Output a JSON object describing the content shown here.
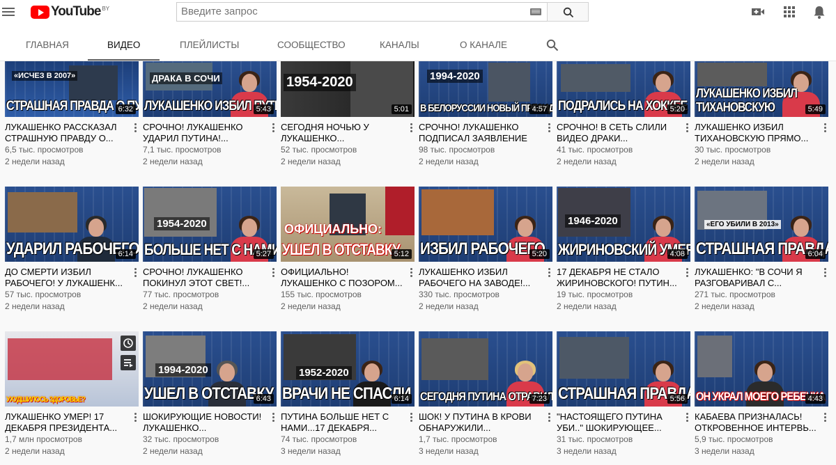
{
  "header": {
    "logo_text": "YouTube",
    "logo_region": "BY",
    "search_placeholder": "Введите запрос"
  },
  "tabs": [
    {
      "label": "ГЛАВНАЯ"
    },
    {
      "label": "ВИДЕО"
    },
    {
      "label": "ПЛЕЙЛИСТЫ"
    },
    {
      "label": "СООБЩЕСТВО"
    },
    {
      "label": "КАНАЛЫ"
    },
    {
      "label": "О КАНАЛЕ"
    }
  ],
  "videos": [
    {
      "thumb_caption": "СТРАШНАЯ ПРАВДА О ПУТИНЕ",
      "thumb_label": "«ИСЧЕЗ В 2007»",
      "duration": "6:32",
      "title": "ЛУКАШЕНКО РАССКАЗАЛ СТРАШНУЮ ПРАВДУ О...",
      "views": "6,5 тыс. просмотров",
      "age": "2 недели назад"
    },
    {
      "thumb_caption": "ЛУКАШЕНКО ИЗБИЛ ПУТИНА",
      "thumb_label": "ДРАКА В СОЧИ",
      "duration": "5:43",
      "title": "СРОЧНО! ЛУКАШЕНКО УДАРИЛ ПУТИНА!...",
      "views": "7,1 тыс. просмотров",
      "age": "2 недели назад"
    },
    {
      "thumb_caption": "",
      "thumb_label": "1954-2020",
      "duration": "5:01",
      "title": "СЕГОДНЯ НОЧЬЮ У ЛУКАШЕНКО...",
      "views": "52 тыс. просмотров",
      "age": "2 недели назад"
    },
    {
      "thumb_caption": "В БЕЛОРУССИИ НОВЫЙ ПРЕЗИДЕНТ",
      "thumb_label": "1994-2020",
      "duration": "4:57",
      "title": "СРОЧНО! ЛУКАШЕНКО ПОДПИСАЛ ЗАЯВЛЕНИЕ О...",
      "views": "98 тыс. просмотров",
      "age": "2 недели назад"
    },
    {
      "thumb_caption": "ПОДРАЛИСЬ НА ХОККЕЕ",
      "thumb_label": "",
      "duration": "5:20",
      "title": "СРОЧНО! В СЕТЬ СЛИЛИ ВИДЕО ДРАКИ...",
      "views": "41 тыс. просмотров",
      "age": "2 недели назад"
    },
    {
      "thumb_caption": "ЛУКАШЕНКО ИЗБИЛ ТИХАНОВСКУЮ",
      "thumb_label": "",
      "duration": "5:49",
      "title": "ЛУКАШЕНКО ИЗБИЛ ТИХАНОВСКУЮ ПРЯМО...",
      "views": "30 тыс. просмотров",
      "age": "2 недели назад"
    },
    {
      "thumb_caption": "УДАРИЛ РАБОЧЕГО",
      "thumb_label": "",
      "duration": "6:14",
      "title": "ДО СМЕРТИ ИЗБИЛ РАБОЧЕГО! У ЛУКАШЕНК...",
      "views": "57 тыс. просмотров",
      "age": "2 недели назад"
    },
    {
      "thumb_caption": "БОЛЬШЕ НЕТ С НАМИ",
      "thumb_label": "1954-2020",
      "duration": "5:27",
      "title": "СРОЧНО! ЛУКАШЕНКО ПОКИНУЛ ЭТОТ СВЕТ!...",
      "views": "77 тыс. просмотров",
      "age": "2 недели назад"
    },
    {
      "thumb_caption": "УШЕЛ В ОТСТАВКУ",
      "thumb_label": "ОФИЦИАЛЬНО:",
      "duration": "5:12",
      "title": "ОФИЦИАЛЬНО! ЛУКАШЕНКО С ПОЗОРОМ...",
      "views": "155 тыс. просмотров",
      "age": "2 недели назад"
    },
    {
      "thumb_caption": "ИЗБИЛ РАБОЧЕГО",
      "thumb_label": "",
      "duration": "5:20",
      "title": "ЛУКАШЕНКО ИЗБИЛ РАБОЧЕГО НА ЗАВОДЕ!...",
      "views": "330 тыс. просмотров",
      "age": "2 недели назад"
    },
    {
      "thumb_caption": "ЖИРИНОВСКИЙ УМЕР",
      "thumb_label": "1946-2020",
      "duration": "4:08",
      "title": "17 ДЕКАБРЯ НЕ СТАЛО ЖИРИНОВСКОГО! ПУТИН...",
      "views": "19 тыс. просмотров",
      "age": "2 недели назад"
    },
    {
      "thumb_caption": "СТРАШНАЯ ПРАВДА",
      "thumb_label": "«ЕГО УБИЛИ В 2013»",
      "duration": "6:04",
      "title": "ЛУКАШЕНКО: \"В СОЧИ Я РАЗГОВАРИВАЛ С...",
      "views": "271 тыс. просмотров",
      "age": "2 недели назад"
    },
    {
      "thumb_caption": "УХУДШИЛОСЬ ЗДОРОВЬЕ?",
      "thumb_label": "",
      "duration": "",
      "title": "ЛУКАШЕНКО УМЕР! 17 ДЕКАБРЯ ПРЕЗИДЕНТА...",
      "views": "1,7 млн просмотров",
      "age": "2 недели назад"
    },
    {
      "thumb_caption": "УШЕЛ В ОТСТАВКУ",
      "thumb_label": "1994-2020",
      "duration": "6:43",
      "title": "ШОКИРУЮЩИЕ НОВОСТИ! ЛУКАШЕНКО...",
      "views": "32 тыс. просмотров",
      "age": "2 недели назад"
    },
    {
      "thumb_caption": "ВРАЧИ НЕ СПАСЛИ",
      "thumb_label": "1952-2020",
      "duration": "6:14",
      "title": "ПУТИНА БОЛЬШЕ НЕТ С НАМИ...17 ДЕКАБРЯ...",
      "views": "74 тыс. просмотров",
      "age": "3 недели назад"
    },
    {
      "thumb_caption": "СЕГОДНЯ ПУТИНА ОТРАВИЛИ",
      "thumb_label": "",
      "duration": "7:23",
      "title": "ШОК! У ПУТИНА В КРОВИ ОБНАРУЖИЛИ...",
      "views": "1,7 тыс. просмотров",
      "age": "3 недели назад"
    },
    {
      "thumb_caption": "СТРАШНАЯ ПРАВДА",
      "thumb_label": "",
      "duration": "5:56",
      "title": "\"НАСТОЯЩЕГО ПУТИНА УБИ..\" ШОКИРУЮЩЕЕ...",
      "views": "31 тыс. просмотров",
      "age": "3 недели назад"
    },
    {
      "thumb_caption": "ОН УКРАЛ МОЕГО РЕБЕНКА",
      "thumb_label": "",
      "duration": "4:43",
      "title": "КАБАЕВА ПРИЗНАЛАСЬ! ОТКРОВЕННОЕ ИНТЕРВЬ...",
      "views": "5,9 тыс. просмотров",
      "age": "3 недели назад"
    }
  ],
  "colors": {
    "brand_red": "#ff0000",
    "studio_blue": "#3c5a8a",
    "anchor_dress": "#d93a4a",
    "text_primary": "#030303",
    "text_secondary": "#606060"
  }
}
